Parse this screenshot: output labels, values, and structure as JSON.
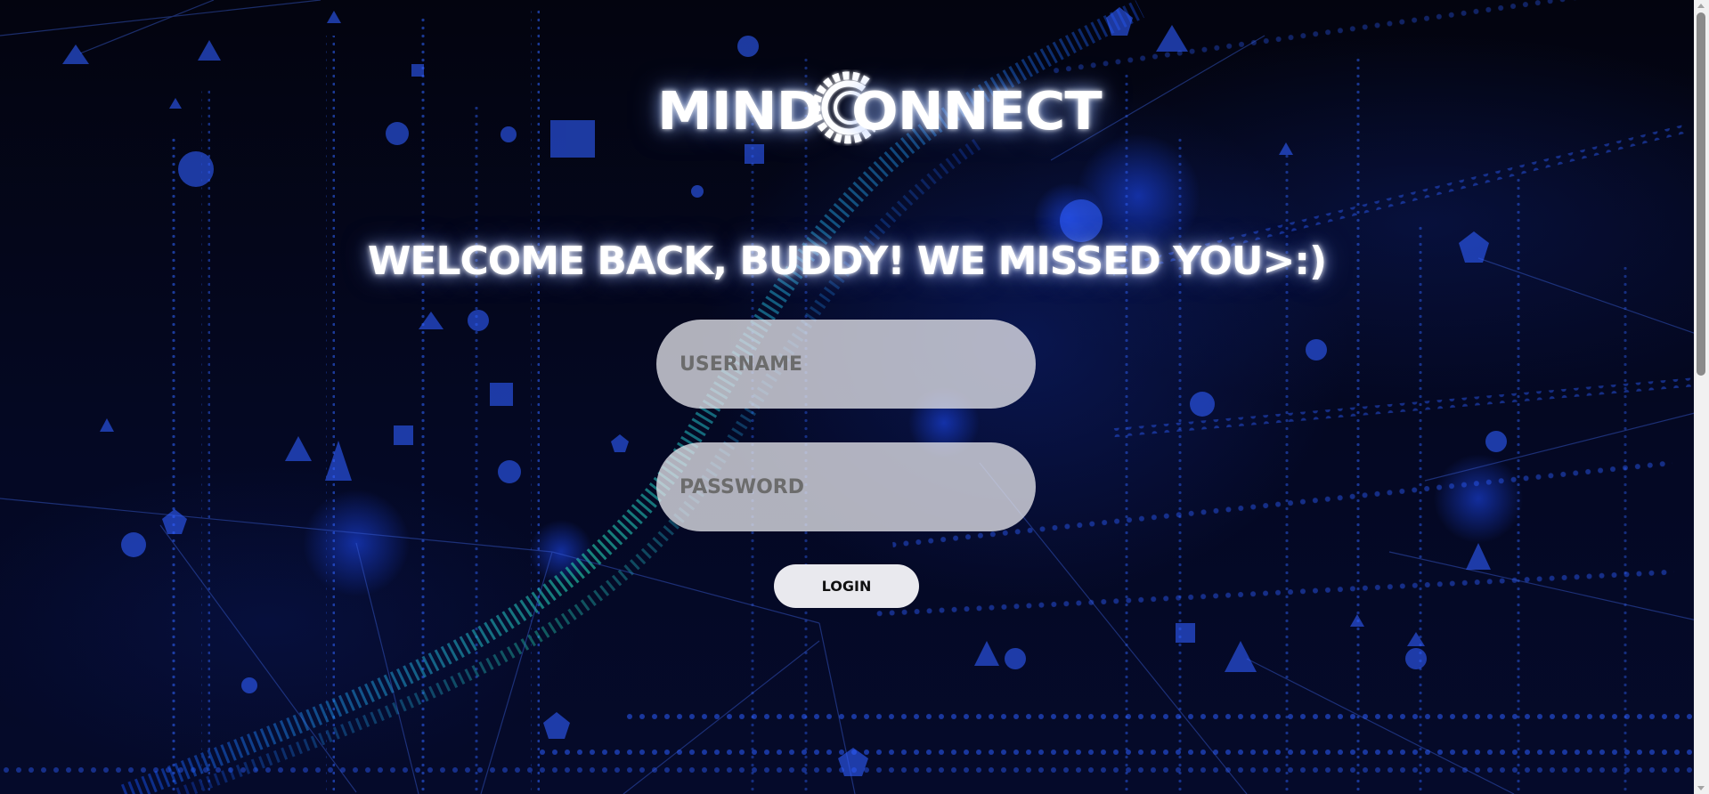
{
  "logo": {
    "left_text": "MIND",
    "right_text": "ONNECT",
    "icon": "gear-c-icon"
  },
  "welcome": "WELCOME BACK, BUDDY! WE MISSED YOU>:)",
  "form": {
    "username_placeholder": "USERNAME",
    "password_placeholder": "PASSWORD",
    "login_label": "LOGIN"
  },
  "theme": {
    "background": "#02030c",
    "accent_blue": "#2a5cff",
    "accent_teal": "#2fd3b0",
    "input_bg": "#e1e1e8",
    "button_bg": "#e9e9ee"
  }
}
